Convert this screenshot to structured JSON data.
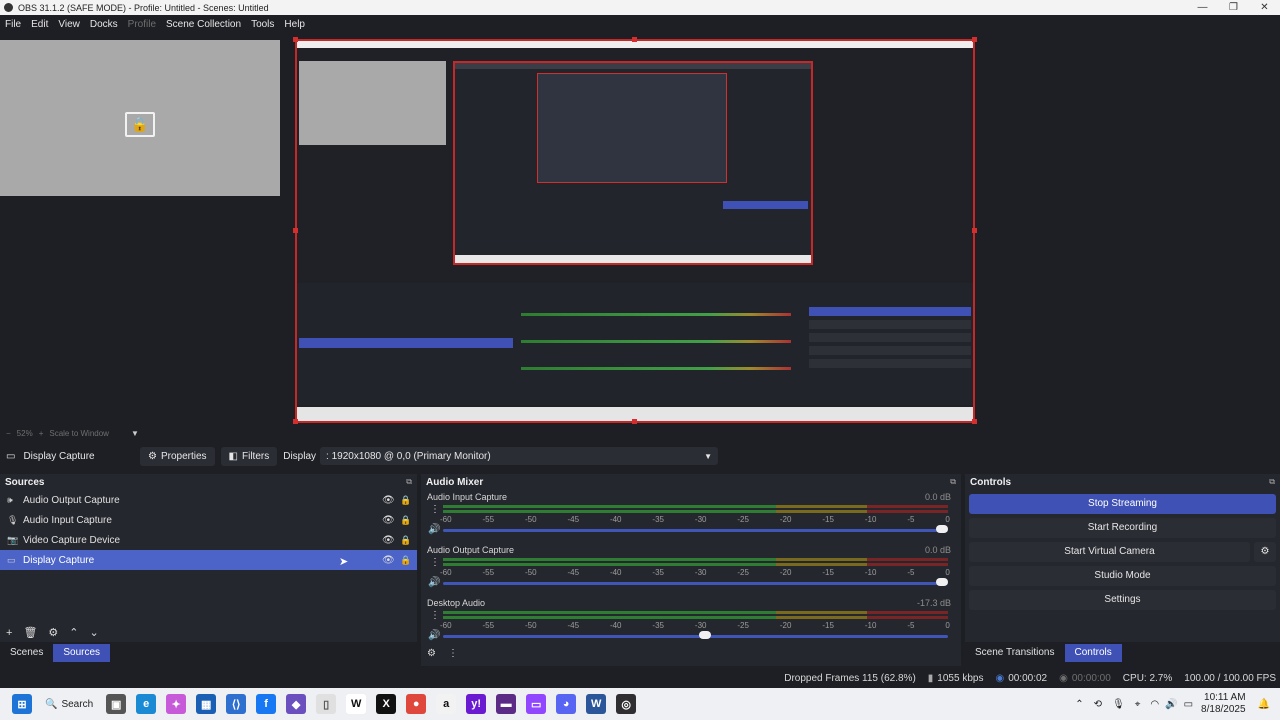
{
  "window": {
    "title": "OBS 31.1.2 (SAFE MODE) - Profile: Untitled - Scenes: Untitled"
  },
  "menu": [
    "File",
    "Edit",
    "View",
    "Docks",
    "Profile",
    "Scene Collection",
    "Tools",
    "Help"
  ],
  "zoom": {
    "percent": "52%",
    "plus": "+",
    "mode": "Scale to Window"
  },
  "source_bar": {
    "selected": "Display Capture",
    "properties": "Properties",
    "filters": "Filters",
    "display_label": "Display",
    "display_value": ": 1920x1080 @ 0,0 (Primary Monitor)"
  },
  "sources": {
    "title": "Sources",
    "items": [
      {
        "label": "Audio Output Capture",
        "icon": "speaker-icon"
      },
      {
        "label": "Audio Input Capture",
        "icon": "microphone-icon"
      },
      {
        "label": "Video Capture Device",
        "icon": "camera-icon"
      },
      {
        "label": "Display Capture",
        "icon": "monitor-icon"
      }
    ]
  },
  "mixer": {
    "title": "Audio Mixer",
    "ticks": [
      "-60",
      "-55",
      "-50",
      "-45",
      "-40",
      "-35",
      "-30",
      "-25",
      "-20",
      "-15",
      "-10",
      "-5",
      "0"
    ],
    "channels": [
      {
        "name": "Audio Input Capture",
        "db": "0.0 dB",
        "volume": 1.0
      },
      {
        "name": "Audio Output Capture",
        "db": "0.0 dB",
        "volume": 1.0
      },
      {
        "name": "Desktop Audio",
        "db": "-17.3 dB",
        "volume": 0.53
      }
    ]
  },
  "controls": {
    "title": "Controls",
    "stop_streaming": "Stop Streaming",
    "start_recording": "Start Recording",
    "start_virtual_camera": "Start Virtual Camera",
    "studio_mode": "Studio Mode",
    "settings": "Settings"
  },
  "tabs": {
    "scenes": "Scenes",
    "sources": "Sources",
    "scene_transitions": "Scene Transitions",
    "controls": "Controls"
  },
  "status": {
    "dropped": "Dropped Frames 115 (62.8%)",
    "kbps": "1055 kbps",
    "stream_time": "00:00:02",
    "rec_time": "00:00:00",
    "cpu": "CPU: 2.7%",
    "fps": "100.00 / 100.00 FPS"
  },
  "taskbar": {
    "search": "Search",
    "time": "10:11 AM",
    "date": "8/18/2025"
  }
}
